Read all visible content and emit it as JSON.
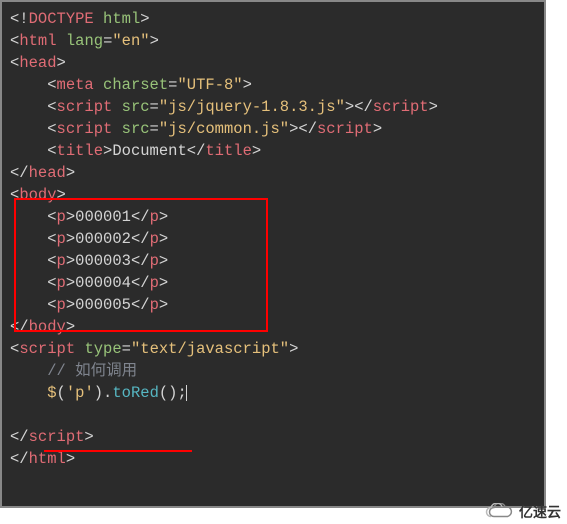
{
  "code": {
    "doctype_open": "<!",
    "doctype_name": "DOCTYPE",
    "doctype_attr": "html",
    "doctype_close": ">",
    "html_tag": "html",
    "html_attr_lang": "lang",
    "html_lang_val": "\"en\"",
    "head_tag": "head",
    "meta_tag": "meta",
    "meta_attr_charset": "charset",
    "meta_charset_val": "\"UTF-8\"",
    "script_tag": "script",
    "script_attr_src": "src",
    "script1_src_val": "\"js/jquery-1.8.3.js\"",
    "script2_src_val": "\"js/common.js\"",
    "title_tag": "title",
    "title_text": "Document",
    "body_tag": "body",
    "p_tag": "p",
    "p1_text": "000001",
    "p2_text": "000002",
    "p3_text": "000003",
    "p4_text": "000004",
    "p5_text": "000005",
    "script_attr_type": "type",
    "script_type_val": "\"text/javascript\"",
    "comment_text": "// 如何调用",
    "jq_dollar": "$",
    "jq_selector": "'p'",
    "jq_method": "toRed",
    "jq_parens": "();"
  },
  "watermark": {
    "text": "亿速云"
  }
}
